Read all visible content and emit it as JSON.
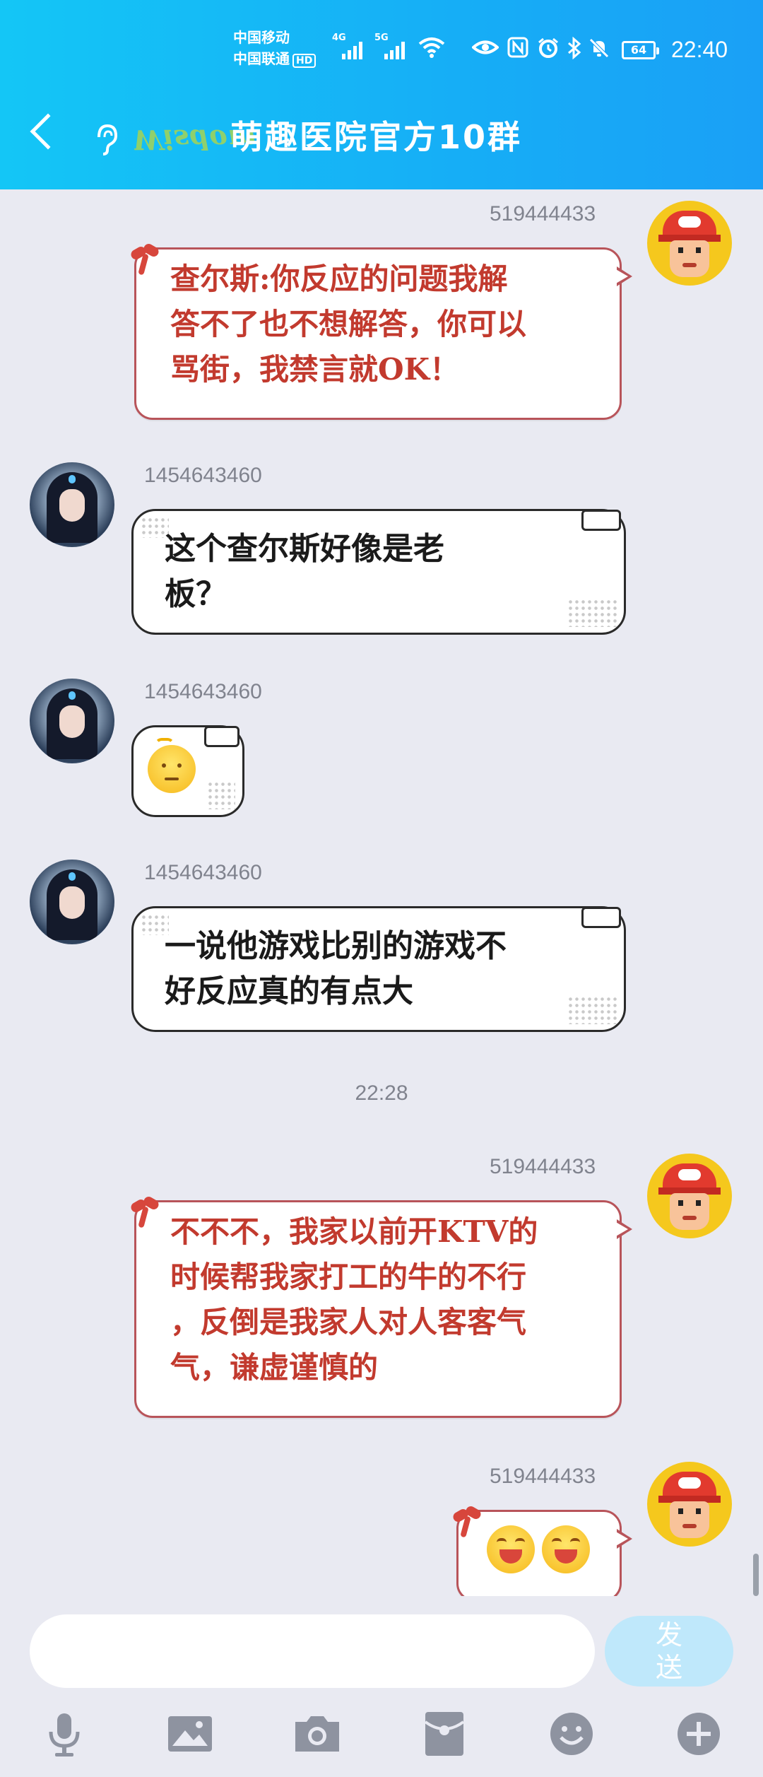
{
  "status_bar": {
    "carrier1": "中国移动",
    "carrier2": "中国联通",
    "hd": "HD",
    "net1": "4G",
    "net2": "5G",
    "battery": "64",
    "time": "22:40"
  },
  "header": {
    "logo_text": "Wisdom",
    "title": "萌趣医院官方10群"
  },
  "messages": [
    {
      "sender": "519444433",
      "side": "right",
      "style": "red",
      "text_lines": [
        "查尔斯:你反应的问题我解",
        "答不了也不想解答，你可以",
        "骂街，我禁言就OK！"
      ]
    },
    {
      "sender": "1454643460",
      "side": "left",
      "style": "white",
      "text_lines": [
        "这个查尔斯好像是老",
        "板？"
      ]
    },
    {
      "sender": "1454643460",
      "side": "left",
      "style": "white",
      "emoji": "calm-face"
    },
    {
      "sender": "1454643460",
      "side": "left",
      "style": "white",
      "text_lines": [
        "一说他游戏比别的游戏不",
        "好反应真的有点大"
      ]
    },
    {
      "timestamp": "22:28"
    },
    {
      "sender": "519444433",
      "side": "right",
      "style": "red",
      "text_lines": [
        "不不不，我家以前开KTV的",
        "时候帮我家打工的牛的不行",
        "，反倒是我家人对人客客气",
        "气，谦虚谨慎的"
      ]
    },
    {
      "sender": "519444433",
      "side": "right",
      "style": "red",
      "emoji": "laughing-face ×2"
    }
  ],
  "composer": {
    "input_value": "",
    "input_placeholder": "",
    "send_label_line1": "发",
    "send_label_line2": "送"
  },
  "toolbar": [
    "microphone-icon",
    "image-icon",
    "camera-icon",
    "red-packet-icon",
    "emoji-icon",
    "plus-icon"
  ],
  "colors": {
    "header_start": "#14c6f6",
    "header_end": "#1aa0f6",
    "background": "#e9eaf2",
    "red_text": "#c23a2e",
    "send_button": "#bfe8fb"
  }
}
